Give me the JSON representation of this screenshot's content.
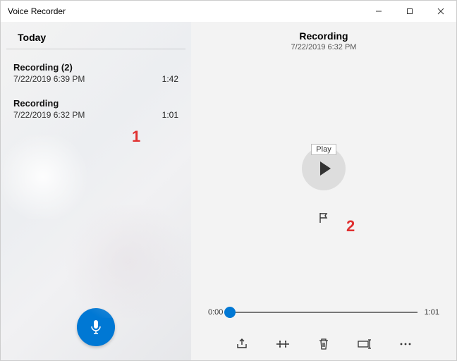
{
  "app": {
    "title": "Voice Recorder"
  },
  "window_controls": {
    "minimize": "minimize",
    "maximize": "maximize",
    "close": "close"
  },
  "sidebar": {
    "section_label": "Today",
    "items": [
      {
        "title": "Recording (2)",
        "date": "7/22/2019 6:39 PM",
        "duration": "1:42"
      },
      {
        "title": "Recording",
        "date": "7/22/2019 6:32 PM",
        "duration": "1:01"
      }
    ],
    "record_button": "Record"
  },
  "detail": {
    "title": "Recording",
    "date": "7/22/2019 6:32 PM",
    "play_tooltip": "Play",
    "flag_button": "Add marker",
    "time_current": "0:00",
    "time_total": "1:01",
    "actions": {
      "share": "Share",
      "trim": "Trim",
      "delete": "Delete",
      "rename": "Rename",
      "more": "More"
    }
  },
  "callouts": {
    "one": "1",
    "two": "2"
  },
  "colors": {
    "accent": "#0078d4"
  }
}
